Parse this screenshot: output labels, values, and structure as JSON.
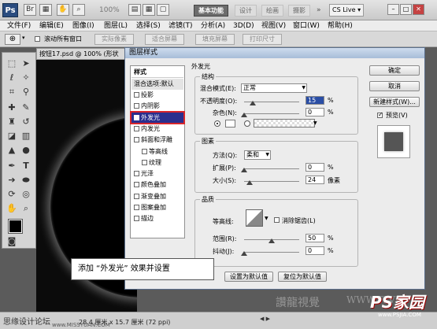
{
  "app": {
    "logo": "Ps",
    "zoom": "100%",
    "workspace_active": "基本功能",
    "workspaces": [
      "设计",
      "绘画",
      "摄影"
    ],
    "cs_live": "CS Live"
  },
  "menus": [
    "文件(F)",
    "编辑(E)",
    "图像(I)",
    "图层(L)",
    "选择(S)",
    "滤镜(T)",
    "分析(A)",
    "3D(D)",
    "视图(V)",
    "窗口(W)",
    "帮助(H)"
  ],
  "options": {
    "all_windows": "滚动所有窗口",
    "btn_actual": "实际像素",
    "btn_fit": "适合屏幕",
    "btn_fill": "填充屏幕",
    "btn_print": "打印尺寸"
  },
  "document": {
    "tab": "按钮17.psd @ 100% (形状"
  },
  "dialog": {
    "title": "图层样式",
    "styles_header": "样式",
    "blend_default": "混合选项:默认",
    "style_items": [
      {
        "label": "投影",
        "checked": false
      },
      {
        "label": "内阴影",
        "checked": false
      },
      {
        "label": "外发光",
        "checked": true
      },
      {
        "label": "内发光",
        "checked": false
      },
      {
        "label": "斜面和浮雕",
        "checked": false
      },
      {
        "label": "等高线",
        "checked": false
      },
      {
        "label": "纹理",
        "checked": false
      },
      {
        "label": "光泽",
        "checked": false
      },
      {
        "label": "颜色叠加",
        "checked": false
      },
      {
        "label": "渐变叠加",
        "checked": false
      },
      {
        "label": "图案叠加",
        "checked": false
      },
      {
        "label": "描边",
        "checked": false
      }
    ],
    "section_title": "外发光",
    "structure": {
      "title": "结构",
      "blend_label": "混合模式(E):",
      "blend_value": "正常",
      "opacity_label": "不透明度(O):",
      "opacity_value": "15",
      "noise_label": "杂色(N):",
      "noise_value": "0",
      "pct": "%",
      "opacity_fraction": 0.15,
      "noise_fraction": 0.0
    },
    "elements": {
      "title": "图素",
      "method_label": "方法(Q):",
      "method_value": "柔和",
      "spread_label": "扩展(P):",
      "spread_value": "0",
      "size_label": "大小(S):",
      "size_value": "24",
      "px": "像素",
      "spread_fraction": 0.0,
      "size_fraction": 0.096
    },
    "quality": {
      "title": "品质",
      "contour_label": "等高线:",
      "antialias_label": "消除锯齿(L)",
      "range_label": "范围(R):",
      "range_value": "50",
      "jitter_label": "抖动(J):",
      "jitter_value": "0",
      "range_fraction": 0.5,
      "jitter_fraction": 0.0
    },
    "btn_set_default": "设置为默认值",
    "btn_reset_default": "复位为默认值",
    "ok": "确定",
    "cancel": "取消",
    "new_style": "新建样式(W)...",
    "preview_label": "预览(V)"
  },
  "callout": "添加 “外发光” 效果并设置",
  "status": {
    "left": "思缘设计论坛",
    "info": "28.4 厘米 x 15.7 厘米 (72 ppi)",
    "site": "www.MISSYUAN.COM"
  },
  "watermark": {
    "logo": "PS家园",
    "url": "www.PSJIA.COM",
    "cn": "讚龍視覺",
    "site": "WWW.TLVI"
  },
  "colors": {
    "selected": "#2a2f8e",
    "highlight": "#d8262b",
    "title_bar": "#a7bdd8"
  }
}
